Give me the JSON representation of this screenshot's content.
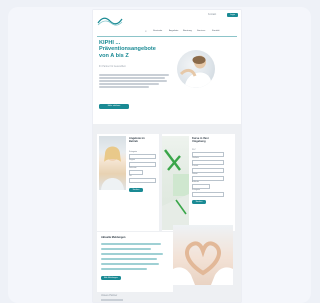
{
  "header": {
    "top_link_label": "Kontakt",
    "cta_label": "Login",
    "nav": [
      "Startseite",
      "Angebote",
      "Beratung",
      "Services",
      "Kontakt"
    ]
  },
  "hero": {
    "title_line1": "KIPHI ...",
    "title_line2": "Präventionsangebote",
    "title_line3": "von A bis Z",
    "subtitle": "Ihr Partner für Gesundheit",
    "button_label": "Mehr erfahren"
  },
  "panels": {
    "left_title_line1": "Angebote im",
    "left_title_line2": "Betrieb",
    "left_button": "Suchen",
    "left_fields": [
      "Kategorie",
      "Region",
      "Zeitraum",
      "Ort",
      "Thema"
    ],
    "right_title_line1": "Kurse in Ihrer",
    "right_title_line2": "Umgebung",
    "right_button": "Suchen",
    "right_fields": [
      "PLZ",
      "Umkreis",
      "Kursart",
      "Datum",
      "Anbieter",
      "Kategorie"
    ]
  },
  "news": {
    "title": "Aktuelle Meldungen",
    "button_label": "Alle Meldungen"
  },
  "bottom": {
    "heading": "Unsere Partner"
  },
  "colors": {
    "accent": "#1a8a94",
    "background": "#eef1f7"
  },
  "icons": [
    "search-icon",
    "logo-icon"
  ]
}
